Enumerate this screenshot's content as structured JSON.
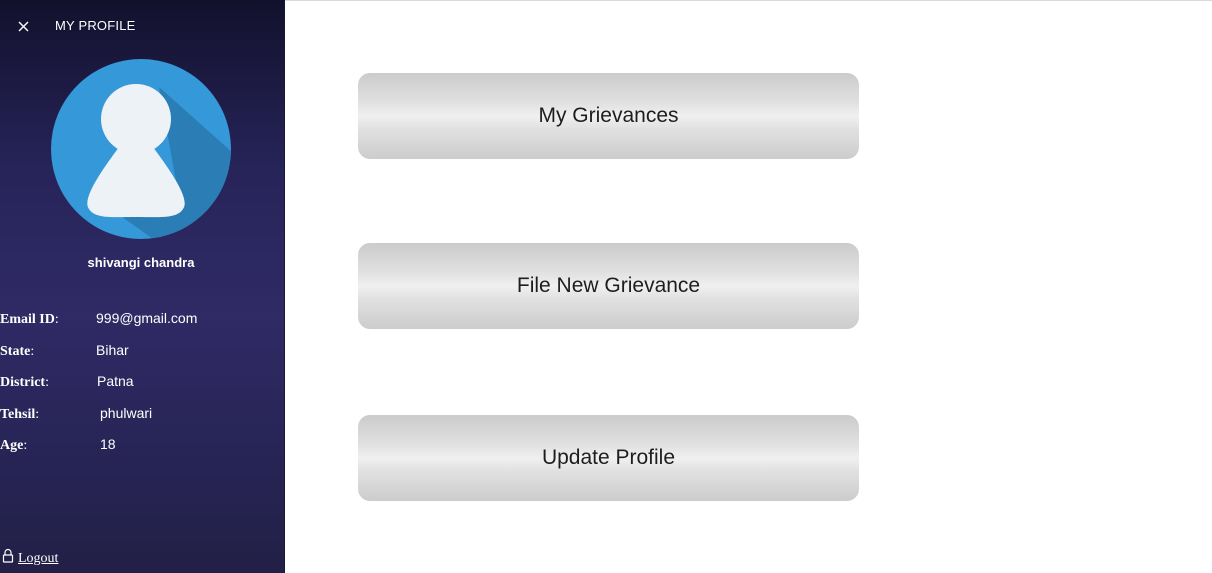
{
  "sidebar": {
    "title": "MY PROFILE",
    "close_icon": "close-icon",
    "avatar_icon": "user-avatar-icon",
    "user_name": "shivangi chandra",
    "fields": [
      {
        "key": "Email ID",
        "colon": ":",
        "value": "999@gmail.com"
      },
      {
        "key": "State",
        "colon": ":",
        "value": "Bihar"
      },
      {
        "key": "District",
        "colon": ":",
        "value": "Patna"
      },
      {
        "key": "Tehsil",
        "colon": ":",
        "value": "phulwari"
      },
      {
        "key": "Age",
        "colon": ":",
        "value": "18"
      }
    ],
    "logout_label": "Logout",
    "logout_icon": "lock-icon"
  },
  "main": {
    "buttons": [
      {
        "label": "My Grievances"
      },
      {
        "label": "File New Grievance"
      },
      {
        "label": "Update Profile"
      }
    ]
  },
  "colors": {
    "sidebar_bg": "#27245a",
    "avatar_circle": "#3598d8",
    "button_bg": "#e1e1e1"
  }
}
